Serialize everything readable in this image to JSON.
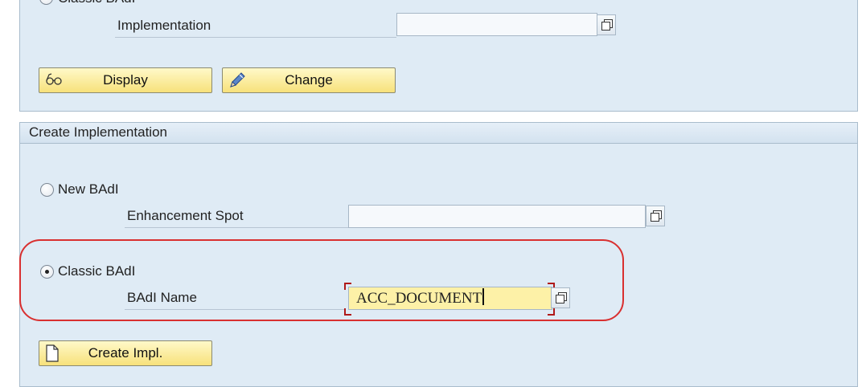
{
  "top_panel": {
    "radio_classic_label": "Classic BAdI",
    "implementation_label": "Implementation",
    "implementation_value": "",
    "display_button": "Display",
    "change_button": "Change"
  },
  "create_panel": {
    "title": "Create Implementation",
    "radio_new_label": "New BAdI",
    "enhancement_spot_label": "Enhancement Spot",
    "enhancement_spot_value": "",
    "radio_classic_label": "Classic BAdI",
    "classic_selected": true,
    "badi_name_label": "BAdI Name",
    "badi_name_value": "ACC_DOCUMENT",
    "create_button": "Create Impl."
  },
  "colors": {
    "panel_bg": "#dfebf5",
    "button_bg": "#f7e17b",
    "active_input_bg": "#fdf1a7",
    "highlight": "#d93030"
  },
  "icons": {
    "display": "glasses-icon",
    "change": "pencil-icon",
    "create": "new-document-icon",
    "value_help": "value-help-icon"
  }
}
